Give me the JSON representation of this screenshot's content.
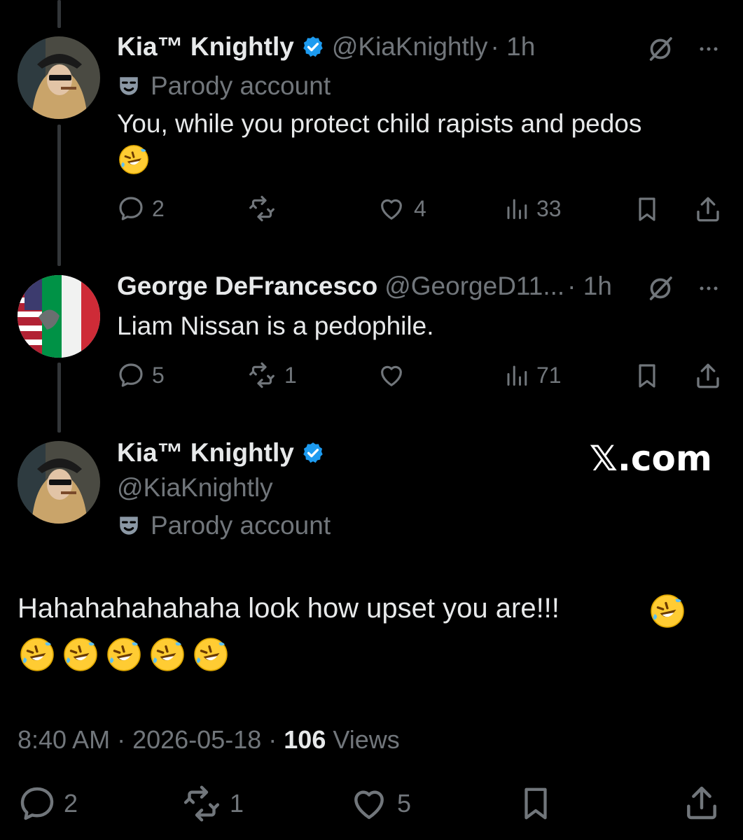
{
  "tweets": [
    {
      "display_name": "Kia™ Knightly",
      "handle": "@KiaKnightly",
      "time": "· 1h",
      "parody_label": "Parody account",
      "text": "You, while you protect child rapists and pedos",
      "emoji": "🤣",
      "replies": "2",
      "reposts": "",
      "likes": "4",
      "views": "33"
    },
    {
      "display_name": "George DeFrancesco",
      "handle": "@GeorgeD11...",
      "time": "· 1h",
      "text": "Liam Nissan is a pedophile.",
      "replies": "5",
      "reposts": "1",
      "likes": "",
      "views": "71"
    }
  ],
  "main_tweet": {
    "display_name": "Kia™ Knightly",
    "handle": "@KiaKnightly",
    "parody_label": "Parody account",
    "text": "Hahahahahahaha look how upset you are!!!",
    "emoji_line": "🤣🤣🤣🤣🤣",
    "time": "8:40 AM",
    "date": "2026-05-18",
    "views_count": "106",
    "views_label": "Views",
    "replies": "2",
    "reposts": "1",
    "likes": "5"
  },
  "watermark": "𝕏.com",
  "colors": {
    "background": "#000000",
    "text": "#e7e9ea",
    "secondary": "#71767b",
    "verified": "#1d9bf0",
    "thread_line": "#333639"
  },
  "icons": {
    "reply": "reply-icon",
    "repost": "repost-icon",
    "like": "heart-icon",
    "views": "views-icon",
    "bookmark": "bookmark-icon",
    "share": "share-icon",
    "grok": "grok-icon",
    "more": "more-icon",
    "parody": "parody-mask-icon"
  }
}
